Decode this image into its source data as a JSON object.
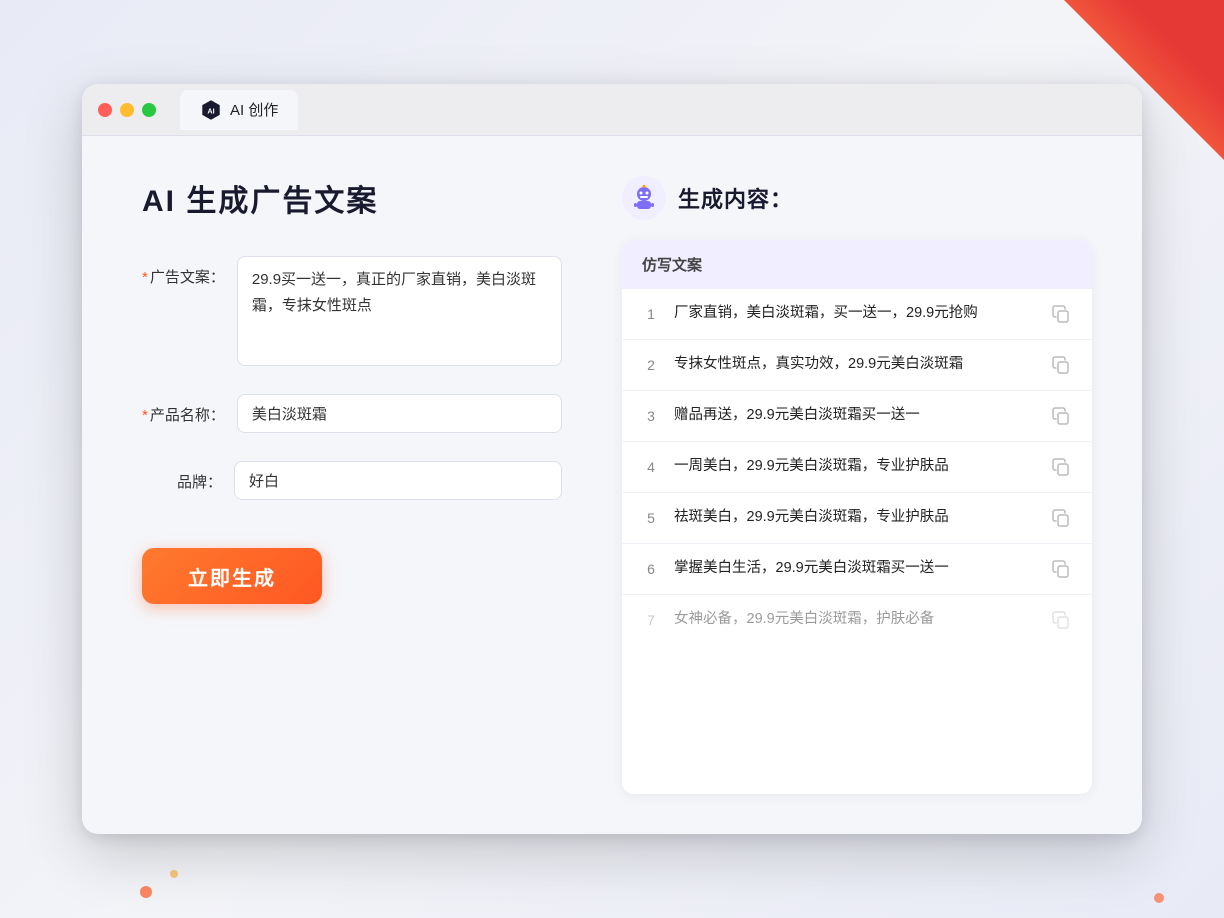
{
  "window": {
    "tab_label": "AI 创作"
  },
  "page": {
    "title": "AI 生成广告文案",
    "result_title": "生成内容："
  },
  "form": {
    "ad_copy_label": "广告文案：",
    "ad_copy_required": "*",
    "ad_copy_value": "29.9买一送一，真正的厂家直销，美白淡斑霜，专抹女性斑点",
    "product_name_label": "产品名称：",
    "product_name_required": "*",
    "product_name_value": "美白淡斑霜",
    "brand_label": "品牌：",
    "brand_value": "好白",
    "generate_button": "立即生成"
  },
  "result": {
    "table_header": "仿写文案",
    "rows": [
      {
        "num": "1",
        "text": "厂家直销，美白淡斑霜，买一送一，29.9元抢购",
        "faded": false
      },
      {
        "num": "2",
        "text": "专抹女性斑点，真实功效，29.9元美白淡斑霜",
        "faded": false
      },
      {
        "num": "3",
        "text": "赠品再送，29.9元美白淡斑霜买一送一",
        "faded": false
      },
      {
        "num": "4",
        "text": "一周美白，29.9元美白淡斑霜，专业护肤品",
        "faded": false
      },
      {
        "num": "5",
        "text": "祛斑美白，29.9元美白淡斑霜，专业护肤品",
        "faded": false
      },
      {
        "num": "6",
        "text": "掌握美白生活，29.9元美白淡斑霜买一送一",
        "faded": false
      },
      {
        "num": "7",
        "text": "女神必备，29.9元美白淡斑霜，护肤必备",
        "faded": true
      }
    ]
  }
}
